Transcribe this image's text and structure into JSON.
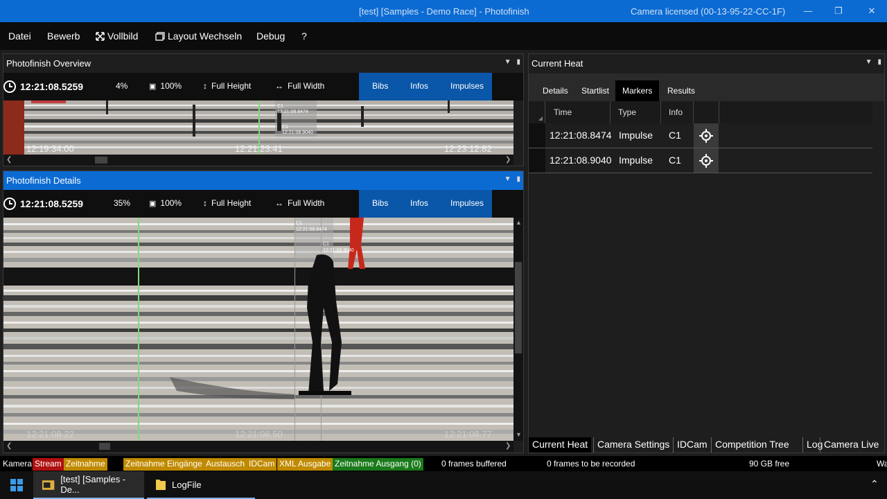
{
  "window": {
    "title": "[test] [Samples - Demo Race] - Photofinish",
    "license": "Camera licensed (00-13-95-22-CC-1F)"
  },
  "menu": [
    "Datei",
    "Bewerb",
    "Vollbild",
    "Layout Wechseln",
    "Debug",
    "?"
  ],
  "overview": {
    "title": "Photofinish Overview",
    "time": "12:21:08.5259",
    "zoom": "4%",
    "scale": "100%",
    "full_height": "Full Height",
    "full_width": "Full Width",
    "bibs": "Bibs",
    "infos": "Infos",
    "impulses": "Impulses",
    "axis": [
      "12:19:34.00",
      "12:21:23.41",
      "12:23:12.82"
    ],
    "markers": [
      {
        "label": "C1",
        "time": "12:21:08.8474"
      },
      {
        "label": "C1",
        "time": "12:21:08.9040"
      }
    ]
  },
  "details": {
    "title": "Photofinish Details",
    "time": "12:21:08.5259",
    "zoom": "35%",
    "scale": "100%",
    "full_height": "Full Height",
    "full_width": "Full Width",
    "bibs": "Bibs",
    "infos": "Infos",
    "impulses": "Impulses",
    "axis": [
      "12:21:08.22",
      "12:21:08.50",
      "12:21:08.77"
    ],
    "markers": [
      {
        "label": "C1",
        "time": "12:21:08.8474"
      },
      {
        "label": "C1",
        "time": "12:21:08.9040"
      }
    ]
  },
  "current_heat": {
    "title": "Current Heat",
    "tabs": [
      "Details",
      "Startlist",
      "Markers",
      "Results"
    ],
    "columns": [
      "Time",
      "Type",
      "Info"
    ],
    "rows": [
      {
        "time": "12:21:08.8474",
        "type": "Impulse",
        "info": "C1"
      },
      {
        "time": "12:21:08.9040",
        "type": "Impulse",
        "info": "C1"
      }
    ],
    "bottom_tabs": [
      "Current Heat",
      "Camera Settings",
      "IDCam",
      "Competition Tree",
      "Log",
      "Camera Live"
    ]
  },
  "status": {
    "kamera": "Kamera",
    "items": [
      {
        "label": "Stream",
        "color": "#b01010"
      },
      {
        "label": "Zeitnahme",
        "color": "#c08a00"
      },
      {
        "label": "Zeitnahme Eingänge",
        "color": "#c08a00"
      },
      {
        "label": "Austausch",
        "color": "#c08a00"
      },
      {
        "label": "IDCam",
        "color": "#c08a00"
      },
      {
        "label": "XML Ausgabe",
        "color": "#c08a00"
      },
      {
        "label": "Zeitnahme Ausgang (0)",
        "color": "#1a7a1a"
      }
    ],
    "buffered": "0 frames buffered",
    "to_record": "0 frames to be recorded",
    "free": "90 GB free",
    "truncated": "Wa"
  },
  "taskbar": {
    "items": [
      "[test] [Samples - De...",
      "LogFile"
    ]
  },
  "colors": {
    "accent": "#0c6bd3",
    "green_line": "#7ddc7d"
  }
}
